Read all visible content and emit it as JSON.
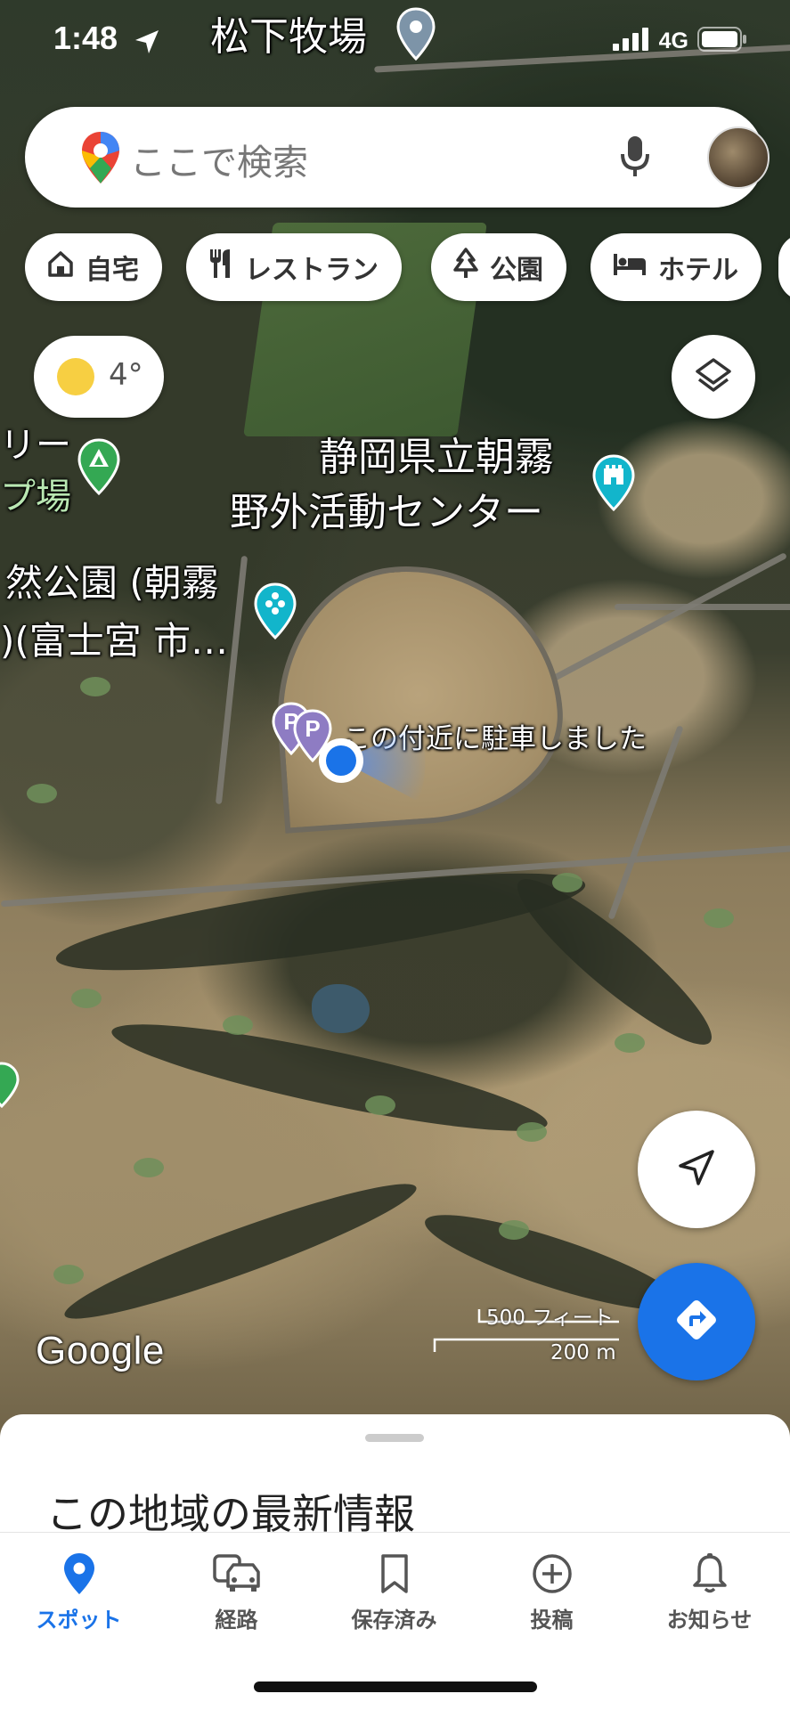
{
  "status_bar": {
    "time": "1:48",
    "location_label": "松下牧場",
    "network": "4G"
  },
  "search": {
    "placeholder": "ここで検索"
  },
  "chips": [
    {
      "label": "自宅",
      "icon": "home-icon"
    },
    {
      "label": "レストラン",
      "icon": "restaurant-icon"
    },
    {
      "label": "公園",
      "icon": "park-icon"
    },
    {
      "label": "ホテル",
      "icon": "hotel-icon"
    }
  ],
  "weather": {
    "temperature": "4°",
    "icon": "sun-icon"
  },
  "map": {
    "labels": {
      "camp_partial_1": "リー",
      "camp_partial_2": "プ場",
      "center_line1": "静岡県立朝霧",
      "center_line2": "野外活動センター",
      "park_line1": "然公園 (朝霧",
      "park_line2": ")(富士宮 市…",
      "parked": "この付近に駐車しました"
    },
    "scale": {
      "feet": "500 フィート",
      "meters": "200 m"
    },
    "logo": "Google"
  },
  "sheet": {
    "title": "この地域の最新情報"
  },
  "tabs": [
    {
      "label": "スポット",
      "icon": "location-pin-icon",
      "active": true
    },
    {
      "label": "経路",
      "icon": "car-icon",
      "active": false
    },
    {
      "label": "保存済み",
      "icon": "bookmark-icon",
      "active": false
    },
    {
      "label": "投稿",
      "icon": "add-circle-icon",
      "active": false
    },
    {
      "label": "お知らせ",
      "icon": "bell-icon",
      "active": false
    }
  ],
  "colors": {
    "accent": "#1a73e8",
    "pin_blue": "#1a73e8",
    "park_green": "#34a853",
    "attraction_teal": "#12b5cb",
    "parking_purple": "#8e7cc3"
  }
}
